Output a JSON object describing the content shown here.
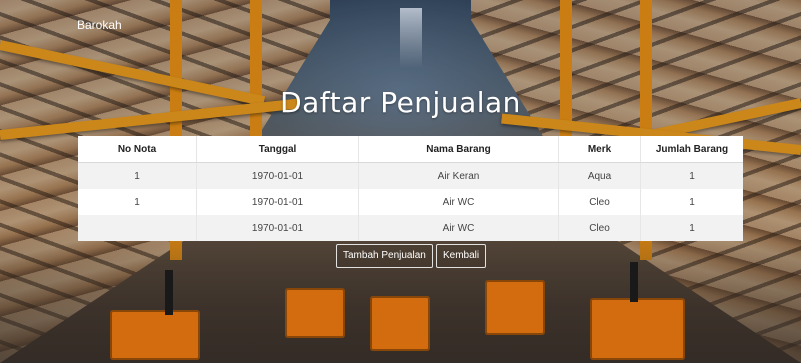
{
  "brand": "Barokah",
  "page_title": "Daftar Penjualan",
  "table": {
    "headers": [
      "No Nota",
      "Tanggal",
      "Nama Barang",
      "Merk",
      "Jumlah Barang"
    ],
    "rows": [
      [
        "1",
        "1970-01-01",
        "Air Keran",
        "Aqua",
        "1"
      ],
      [
        "1",
        "1970-01-01",
        "Air WC",
        "Cleo",
        "1"
      ],
      [
        "",
        "1970-01-01",
        "Air WC",
        "Cleo",
        "1"
      ]
    ]
  },
  "buttons": {
    "add_label": "Tambah Penjualan",
    "back_label": "Kembali"
  }
}
